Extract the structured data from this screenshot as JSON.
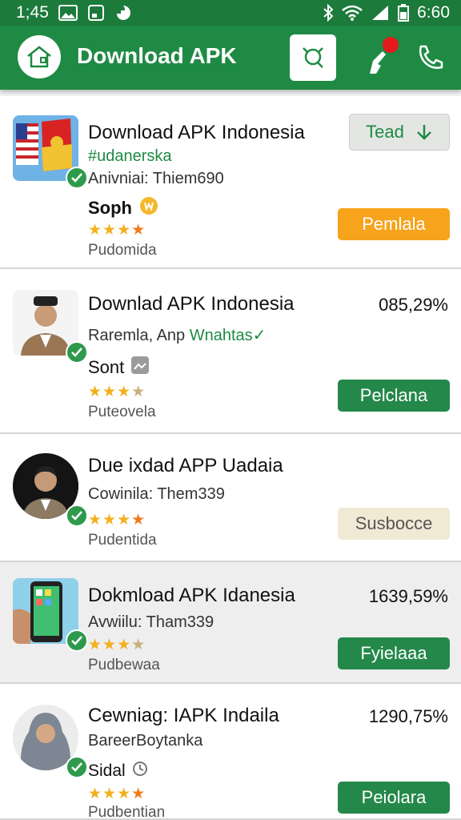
{
  "status_bar": {
    "time": "1;45",
    "battery_time": "6:60"
  },
  "app_bar": {
    "title": "Download APK"
  },
  "items": [
    {
      "title": "Download APK Indonesia",
      "subtitle": "#udanerska",
      "line": "Anivniai: Thiem690",
      "name": "Soph",
      "meta": "Pudomida",
      "action": "Pemlala",
      "lead": "Tead",
      "stars": 4
    },
    {
      "title": "Downlad APK Indonesia",
      "subtitle_a": "Raremla, Anp ",
      "subtitle_b": "Wnahtas✓",
      "name": "Sont",
      "meta": "Puteovela",
      "percent": "085,29%",
      "action": "Pelclana",
      "stars": 4
    },
    {
      "title": "Due ixdad APP Uadaia",
      "line": "Cowinila: Them339",
      "meta": "Pudentida",
      "action": "Susbocce",
      "stars": 4
    },
    {
      "title": "Dokmload APK Idanesia",
      "line": "Avwiilu: Tham339",
      "meta": "Pudbewaa",
      "percent": "1639,59%",
      "action": "Fyielaaa",
      "stars": 4
    },
    {
      "title": "Cewniag: IAPK Indaila",
      "line": "BareerBoytanka",
      "name": "Sidal",
      "meta": "Pudbentian",
      "percent": "1290,75%",
      "action": "Peiolara",
      "stars": 4
    }
  ],
  "colors": {
    "primary": "#1f8a44",
    "accent_orange": "#f7a31c",
    "notification": "#e31b1b"
  }
}
